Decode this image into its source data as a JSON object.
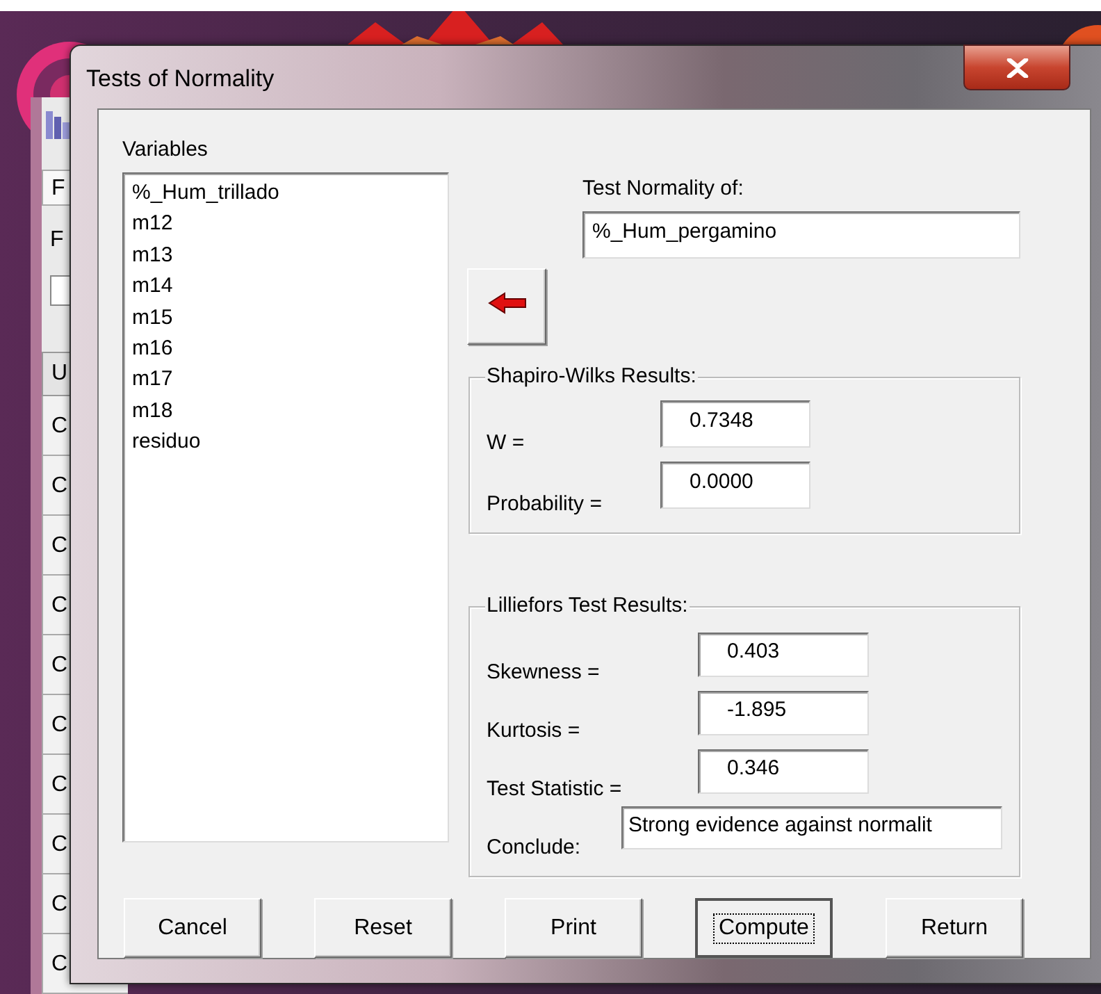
{
  "background_window": {
    "toolbar": [
      "F",
      "F"
    ],
    "header": "U",
    "cells": [
      "C",
      "C",
      "C",
      "C",
      "C",
      "C",
      "C",
      "C",
      "C",
      "C"
    ]
  },
  "window": {
    "title": "Tests of Normality"
  },
  "variables": {
    "label": "Variables",
    "items": [
      "%_Hum_trillado",
      "m12",
      "m13",
      "m14",
      "m15",
      "m16",
      "m17",
      "m18",
      "residuo"
    ]
  },
  "target": {
    "label": "Test Normality of:",
    "value": "%_Hum_pergamino"
  },
  "shapiro_wilks": {
    "title": "Shapiro-Wilks Results:",
    "rows": [
      {
        "label": "W =",
        "value": "0.7348"
      },
      {
        "label": "Probability =",
        "value": "0.0000"
      }
    ]
  },
  "lilliefors": {
    "title": "Lilliefors Test Results:",
    "rows": [
      {
        "label": "Skewness =",
        "value": "0.403"
      },
      {
        "label": "Kurtosis =",
        "value": "-1.895"
      },
      {
        "label": "Test Statistic =",
        "value": "0.346"
      }
    ],
    "conclude": {
      "label": "Conclude:",
      "value": "Strong evidence against normalit"
    }
  },
  "buttons": [
    {
      "label": "Cancel",
      "focused": false
    },
    {
      "label": "Reset",
      "focused": false
    },
    {
      "label": "Print",
      "focused": false
    },
    {
      "label": "Compute",
      "focused": true
    },
    {
      "label": "Return",
      "focused": false
    }
  ]
}
